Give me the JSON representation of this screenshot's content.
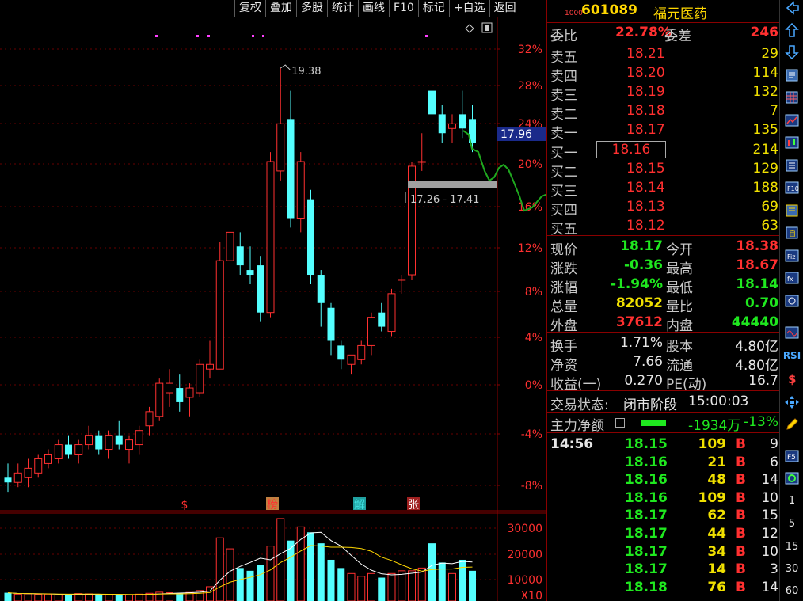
{
  "toolbar": {
    "items": [
      "复权",
      "叠加",
      "多股",
      "统计",
      "画线",
      "F10",
      "标记",
      "+自选",
      "返回"
    ]
  },
  "chart": {
    "price_axis": [
      "32%",
      "28%",
      "24%",
      "20%",
      "16%",
      "12%",
      "8%",
      "4%",
      "0%",
      "-4%",
      "-8%"
    ],
    "vol_axis": [
      "30000",
      "20000",
      "10000",
      "X10"
    ],
    "high_label": "19.38",
    "range_label": "17.26 - 17.41",
    "current_price_tag": "17.96",
    "markers": [
      "$",
      "榜",
      "解",
      "张"
    ],
    "colors": {
      "up": "#ff3030",
      "down": "#54ffff",
      "ma5": "#ffffff",
      "ma10": "#ffd700",
      "green_line": "#1fa81f",
      "grid": "#8a0000"
    }
  },
  "chart_data": {
    "type": "candlestick",
    "candles": [
      {
        "o": 10.7,
        "h": 11.0,
        "l": 10.4,
        "c": 10.6
      },
      {
        "o": 10.6,
        "h": 11.0,
        "l": 10.5,
        "c": 10.8
      },
      {
        "o": 10.7,
        "h": 11.1,
        "l": 10.5,
        "c": 10.9
      },
      {
        "o": 10.8,
        "h": 11.2,
        "l": 10.7,
        "c": 11.1
      },
      {
        "o": 11.0,
        "h": 11.3,
        "l": 10.9,
        "c": 11.2
      },
      {
        "o": 11.1,
        "h": 11.5,
        "l": 11.0,
        "c": 11.4
      },
      {
        "o": 11.4,
        "h": 11.6,
        "l": 11.1,
        "c": 11.2
      },
      {
        "o": 11.2,
        "h": 11.5,
        "l": 11.0,
        "c": 11.4
      },
      {
        "o": 11.4,
        "h": 11.8,
        "l": 11.3,
        "c": 11.6
      },
      {
        "o": 11.6,
        "h": 11.7,
        "l": 11.2,
        "c": 11.3
      },
      {
        "o": 11.3,
        "h": 11.7,
        "l": 11.1,
        "c": 11.6
      },
      {
        "o": 11.6,
        "h": 11.9,
        "l": 11.3,
        "c": 11.4
      },
      {
        "o": 11.3,
        "h": 11.6,
        "l": 11.0,
        "c": 11.5
      },
      {
        "o": 11.4,
        "h": 11.8,
        "l": 11.2,
        "c": 11.7
      },
      {
        "o": 11.8,
        "h": 12.2,
        "l": 11.6,
        "c": 12.1
      },
      {
        "o": 12.0,
        "h": 12.8,
        "l": 11.9,
        "c": 12.7
      },
      {
        "o": 12.5,
        "h": 13.0,
        "l": 12.2,
        "c": 12.7
      },
      {
        "o": 12.6,
        "h": 12.9,
        "l": 12.1,
        "c": 12.3
      },
      {
        "o": 12.4,
        "h": 12.7,
        "l": 12.0,
        "c": 12.6
      },
      {
        "o": 12.5,
        "h": 13.2,
        "l": 12.4,
        "c": 13.1
      },
      {
        "o": 13.0,
        "h": 13.6,
        "l": 12.8,
        "c": 13.1
      },
      {
        "o": 13.0,
        "h": 15.7,
        "l": 13.0,
        "c": 15.3
      },
      {
        "o": 15.3,
        "h": 16.2,
        "l": 14.9,
        "c": 15.9
      },
      {
        "o": 15.6,
        "h": 15.9,
        "l": 15.0,
        "c": 15.2
      },
      {
        "o": 15.1,
        "h": 15.6,
        "l": 14.8,
        "c": 15.0
      },
      {
        "o": 15.2,
        "h": 15.4,
        "l": 14.0,
        "c": 14.2
      },
      {
        "o": 14.2,
        "h": 17.6,
        "l": 14.1,
        "c": 17.4
      },
      {
        "o": 17.2,
        "h": 19.38,
        "l": 17.0,
        "c": 18.2
      },
      {
        "o": 18.3,
        "h": 18.9,
        "l": 16.0,
        "c": 16.2
      },
      {
        "o": 16.2,
        "h": 17.6,
        "l": 15.9,
        "c": 17.4
      },
      {
        "o": 16.6,
        "h": 16.8,
        "l": 14.8,
        "c": 15.0
      },
      {
        "o": 15.0,
        "h": 15.1,
        "l": 13.9,
        "c": 14.4
      },
      {
        "o": 14.3,
        "h": 14.4,
        "l": 13.3,
        "c": 13.6
      },
      {
        "o": 13.5,
        "h": 13.6,
        "l": 13.0,
        "c": 13.2
      },
      {
        "o": 13.1,
        "h": 13.3,
        "l": 12.9,
        "c": 13.3
      },
      {
        "o": 13.2,
        "h": 13.6,
        "l": 13.1,
        "c": 13.5
      },
      {
        "o": 13.5,
        "h": 14.2,
        "l": 13.3,
        "c": 14.1
      },
      {
        "o": 14.2,
        "h": 14.4,
        "l": 13.8,
        "c": 13.9
      },
      {
        "o": 13.8,
        "h": 14.7,
        "l": 13.7,
        "c": 14.6
      },
      {
        "o": 14.9,
        "h": 15.0,
        "l": 14.6,
        "c": 14.9
      },
      {
        "o": 15.0,
        "h": 17.4,
        "l": 14.9,
        "c": 17.3
      },
      {
        "o": 17.4,
        "h": 18.0,
        "l": 17.2,
        "c": 17.4
      },
      {
        "o": 18.9,
        "h": 19.5,
        "l": 17.3,
        "c": 18.4
      },
      {
        "o": 18.4,
        "h": 18.6,
        "l": 17.8,
        "c": 18.0
      },
      {
        "o": 18.1,
        "h": 18.4,
        "l": 17.8,
        "c": 18.2
      },
      {
        "o": 18.4,
        "h": 18.9,
        "l": 17.9,
        "c": 18.1
      },
      {
        "o": 18.3,
        "h": 18.6,
        "l": 17.6,
        "c": 17.8
      }
    ],
    "volume": [
      3000,
      2500,
      2600,
      2400,
      2500,
      2200,
      2300,
      2700,
      2600,
      2300,
      2400,
      2100,
      2200,
      2500,
      2800,
      3200,
      3000,
      2900,
      3100,
      3800,
      5200,
      23000,
      19000,
      12000,
      11000,
      13000,
      20000,
      30000,
      22000,
      27000,
      25000,
      21000,
      15000,
      12000,
      10000,
      9000,
      10000,
      8500,
      10000,
      11000,
      11000,
      12000,
      21000,
      14000,
      10000,
      15000,
      11000
    ],
    "ylim": [
      10.0,
      19.9
    ]
  },
  "quote": {
    "code": "601089",
    "name": "福元医药",
    "tiny": "1000",
    "weibi_label": "委比",
    "weibi": "22.78%",
    "weicha_label": "委差",
    "weicha": "246",
    "asks": [
      {
        "label": "卖五",
        "price": "18.21",
        "vol": "29"
      },
      {
        "label": "卖四",
        "price": "18.20",
        "vol": "114"
      },
      {
        "label": "卖三",
        "price": "18.19",
        "vol": "132"
      },
      {
        "label": "卖二",
        "price": "18.18",
        "vol": "7"
      },
      {
        "label": "卖一",
        "price": "18.17",
        "vol": "135"
      }
    ],
    "bids": [
      {
        "label": "买一",
        "price": "18.16",
        "vol": "214"
      },
      {
        "label": "买二",
        "price": "18.15",
        "vol": "129"
      },
      {
        "label": "买三",
        "price": "18.14",
        "vol": "188"
      },
      {
        "label": "买四",
        "price": "18.13",
        "vol": "69"
      },
      {
        "label": "买五",
        "price": "18.12",
        "vol": "63"
      }
    ],
    "stats": [
      {
        "l1": "现价",
        "v1": "18.17",
        "c1": "g",
        "l2": "今开",
        "v2": "18.38",
        "c2": "r"
      },
      {
        "l1": "涨跌",
        "v1": "-0.36",
        "c1": "g",
        "l2": "最高",
        "v2": "18.67",
        "c2": "r"
      },
      {
        "l1": "涨幅",
        "v1": "-1.94%",
        "c1": "g",
        "l2": "最低",
        "v2": "18.14",
        "c2": "g"
      },
      {
        "l1": "总量",
        "v1": "82052",
        "c1": "y",
        "l2": "量比",
        "v2": "0.70",
        "c2": "g"
      },
      {
        "l1": "外盘",
        "v1": "37612",
        "c1": "r",
        "l2": "内盘",
        "v2": "44440",
        "c2": "g"
      }
    ],
    "fin": [
      {
        "l1": "换手",
        "v1": "1.71%",
        "l2": "股本",
        "v2": "4.80亿"
      },
      {
        "l1": "净资",
        "v1": "7.66",
        "l2": "流通",
        "v2": "4.80亿"
      },
      {
        "l1": "收益(一)",
        "v1": "0.270",
        "l2": "PE(动)",
        "v2": "16.7"
      }
    ],
    "status_label": "交易状态:",
    "status": "闭市阶段",
    "status_time": "15:00:03",
    "main_label": "主力净额",
    "main_amount": "-1934万",
    "main_pct": "-13%",
    "trades_time": "14:56",
    "trades": [
      {
        "p": "18.15",
        "v": "109",
        "s": "B",
        "n": "9"
      },
      {
        "p": "18.16",
        "v": "21",
        "s": "B",
        "n": "6"
      },
      {
        "p": "18.16",
        "v": "48",
        "s": "B",
        "n": "14"
      },
      {
        "p": "18.16",
        "v": "109",
        "s": "B",
        "n": "10"
      },
      {
        "p": "18.17",
        "v": "62",
        "s": "B",
        "n": "15"
      },
      {
        "p": "18.17",
        "v": "44",
        "s": "B",
        "n": "12"
      },
      {
        "p": "18.17",
        "v": "34",
        "s": "B",
        "n": "10"
      },
      {
        "p": "18.17",
        "v": "14",
        "s": "B",
        "n": "3"
      },
      {
        "p": "18.18",
        "v": "76",
        "s": "B",
        "n": "14"
      }
    ]
  },
  "sidebar": {
    "labels": [
      "RSI"
    ],
    "numbers": [
      "1",
      "5",
      "15",
      "30",
      "60"
    ]
  }
}
